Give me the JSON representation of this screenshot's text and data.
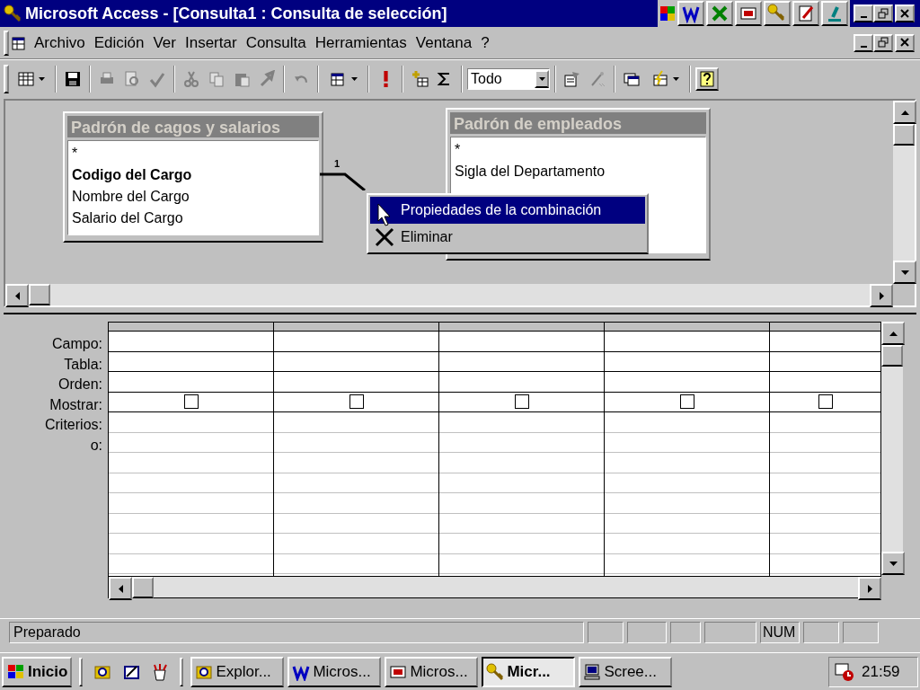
{
  "window": {
    "title": "Microsoft Access - [Consulta1 : Consulta de selección]"
  },
  "menu_bar": {
    "items": [
      "Archivo",
      "Edición",
      "Ver",
      "Insertar",
      "Consulta",
      "Herramientas",
      "Ventana",
      "?"
    ]
  },
  "toolbar": {
    "combo_value": "Todo"
  },
  "tables": [
    {
      "title": "Padrón de cagos y salarios",
      "fields": [
        {
          "name": "*",
          "key": false
        },
        {
          "name": "Codigo del Cargo",
          "key": true
        },
        {
          "name": "Nombre del Cargo",
          "key": false
        },
        {
          "name": "Salario del Cargo",
          "key": false
        }
      ]
    },
    {
      "title": "Padrón de empleados",
      "fields": [
        {
          "name": "*",
          "key": false
        },
        {
          "name": "Sigla del Departamento",
          "key": false
        }
      ]
    }
  ],
  "join": {
    "label": "1"
  },
  "context_menu": {
    "items": [
      {
        "label": "Propiedades de la combinación",
        "selected": true
      },
      {
        "label": "Eliminar",
        "selected": false
      }
    ]
  },
  "grid": {
    "row_labels": [
      "Campo:",
      "Tabla:",
      "Orden:",
      "Mostrar:",
      "Criterios:",
      "o:"
    ],
    "columns": [
      {
        "show": false
      },
      {
        "show": false
      },
      {
        "show": false
      },
      {
        "show": false
      },
      {
        "show": false
      }
    ]
  },
  "status_bar": {
    "text": "Preparado",
    "num_indicator": "NUM"
  },
  "taskbar": {
    "start": "Inicio",
    "tasks": [
      {
        "label": "Explor...",
        "kind": "explorer",
        "selected": false
      },
      {
        "label": "Micros...",
        "kind": "word",
        "selected": false
      },
      {
        "label": "Micros...",
        "kind": "powerpoint",
        "selected": false
      },
      {
        "label": "Micr...",
        "kind": "access",
        "selected": true
      },
      {
        "label": "Scree...",
        "kind": "computer",
        "selected": false
      }
    ],
    "clock": "21:59"
  }
}
